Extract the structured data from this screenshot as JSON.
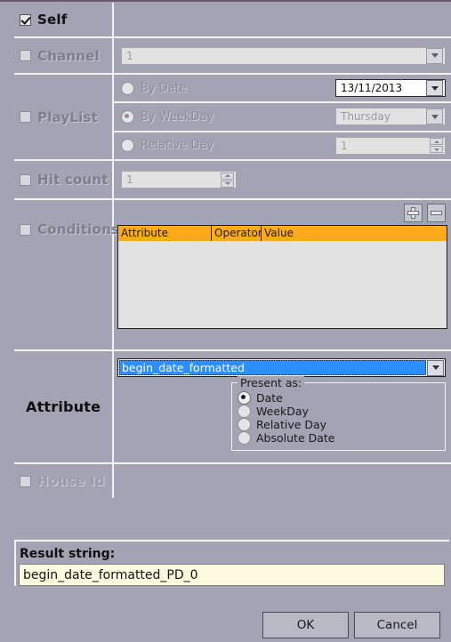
{
  "rows": {
    "self": {
      "label": "Self",
      "checked": true,
      "enabled": true
    },
    "channel": {
      "label": "Channel",
      "checked": false,
      "enabled": false,
      "value": "1"
    },
    "playlist": {
      "label": "PlayList",
      "checked": false,
      "enabled": false
    },
    "hitcount": {
      "label": "Hit count",
      "checked": false,
      "enabled": false,
      "value": "1"
    },
    "conditions": {
      "label": "Conditions",
      "checked": false,
      "enabled": false
    },
    "attribute": {
      "label": "Attribute"
    },
    "houseid": {
      "label": "House Id",
      "checked": false,
      "enabled": false
    }
  },
  "playlist_options": [
    {
      "label": "By Date",
      "selected": false,
      "value": "13/11/2013",
      "control": "dropdown",
      "enabled": true
    },
    {
      "label": "By WeekDay",
      "selected": true,
      "value": "Thursday",
      "control": "dropdown",
      "enabled": false
    },
    {
      "label": "Relative Day",
      "selected": false,
      "value": "1",
      "control": "spinner",
      "enabled": false
    }
  ],
  "conditions": {
    "add_button": "+",
    "remove_button": "-",
    "columns": [
      "Attribute",
      "Operator",
      "Value"
    ],
    "rows": []
  },
  "attribute": {
    "selected_value": "begin_date_formatted",
    "present_as": {
      "title": "Present as:",
      "options": [
        {
          "label": "Date",
          "selected": true
        },
        {
          "label": "WeekDay",
          "selected": false
        },
        {
          "label": "Relative Day",
          "selected": false
        },
        {
          "label": "Absolute Date",
          "selected": false
        }
      ]
    }
  },
  "result": {
    "label": "Result string:",
    "value": "begin_date_formatted_PD_0"
  },
  "buttons": {
    "ok": "OK",
    "cancel": "Cancel"
  },
  "colors": {
    "background": "#a3a3b4",
    "table_header": "#ffab19",
    "selection": "#2a8fff",
    "result_field": "#fdfbdf"
  }
}
